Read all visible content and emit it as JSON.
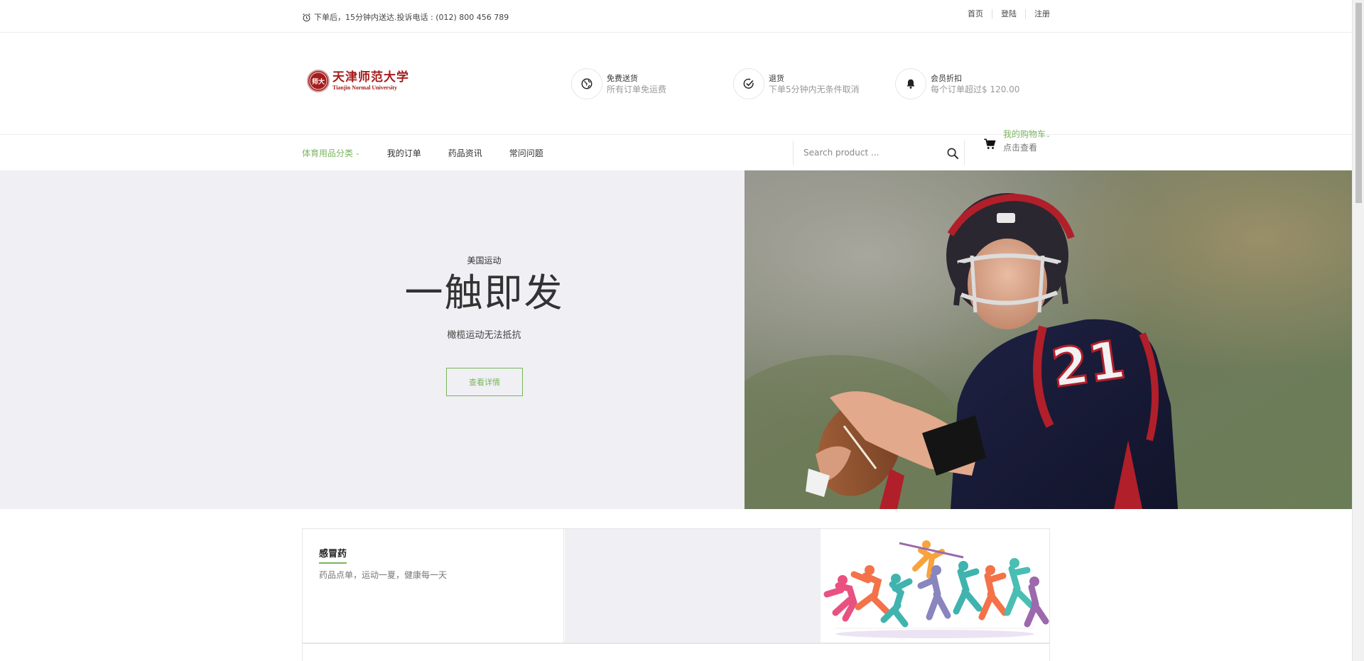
{
  "topbar": {
    "notice": "下单后，15分钟内送达.投诉电话 : (012) 800 456 789",
    "links": [
      "首页",
      "登陆",
      "注册"
    ]
  },
  "brand": {
    "seal_text": "师大",
    "name_cn": "天津师范大学",
    "name_en": "Tianjin Normal University"
  },
  "features": [
    {
      "icon": "globe-icon",
      "title": "免费送货",
      "desc": "所有订单免运费"
    },
    {
      "icon": "check-circle-icon",
      "title": "退货",
      "desc": "下单5分钟内无条件取消"
    },
    {
      "icon": "bell-icon",
      "title": "会员折扣",
      "desc": "每个订单超过$ 120.00"
    }
  ],
  "nav": {
    "items": [
      "体育用品分类",
      "我的订单",
      "药品资讯",
      "常问问题"
    ],
    "active_index": 0
  },
  "search": {
    "placeholder": "Search product ..."
  },
  "cart": {
    "label": "我的购物车",
    "sub": "点击查看"
  },
  "hero": {
    "kicker": "美国运动",
    "headline": "一触即发",
    "subtitle": "橄榄运动无法抵抗",
    "button": "查看详情"
  },
  "banner": {
    "title": "感冒药",
    "desc": "药品点单，运动一夏，健康每一天"
  },
  "colors": {
    "accent": "#7ab55c",
    "hero_bg": "#efeff4",
    "brand_red": "#a51c1c"
  }
}
